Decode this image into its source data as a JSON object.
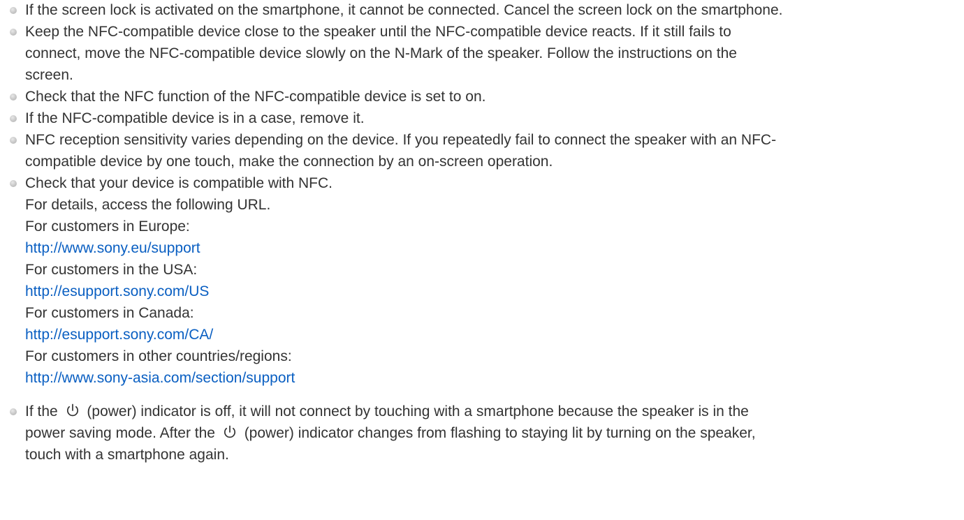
{
  "items": [
    {
      "text": "If the screen lock is activated on the smartphone, it cannot be connected. Cancel the screen lock on the smartphone."
    },
    {
      "lines": [
        "Keep the NFC-compatible device close to the speaker until the NFC-compatible device reacts. If it still fails to",
        "connect, move the NFC-compatible device slowly on the N-Mark of the speaker. Follow the instructions on the",
        "screen."
      ]
    },
    {
      "text": "Check that the NFC function of the NFC-compatible device is set to on."
    },
    {
      "text": "If the NFC-compatible device is in a case, remove it."
    },
    {
      "lines": [
        "NFC reception sensitivity varies depending on the device. If you repeatedly fail to connect the speaker with an NFC-",
        "compatible device by one touch, make the connection by an on-screen operation."
      ]
    },
    {
      "text": "Check that your device is compatible with NFC.",
      "details": "For details, access the following URL.",
      "regions": [
        {
          "label": "For customers in Europe:",
          "url": "http://www.sony.eu/support"
        },
        {
          "label": "For customers in the USA:",
          "url": "http://esupport.sony.com/US"
        },
        {
          "label": "For customers in Canada:",
          "url": "http://esupport.sony.com/CA/"
        },
        {
          "label": "For customers in other countries/regions:",
          "url": "http://www.sony-asia.com/section/support"
        }
      ]
    },
    {
      "line1_a": "If the",
      "line1_b": "(power) indicator is off, it will not connect by touching with a smartphone because the speaker is in the",
      "line2_a": "power saving mode. After the",
      "line2_b": "(power) indicator changes from flashing to staying lit by turning on the speaker,",
      "line3": "touch with a smartphone again.",
      "icon": "power-icon"
    }
  ],
  "colors": {
    "text": "#333333",
    "link": "#0a5fc2",
    "bullet": "#c4c4c4"
  }
}
